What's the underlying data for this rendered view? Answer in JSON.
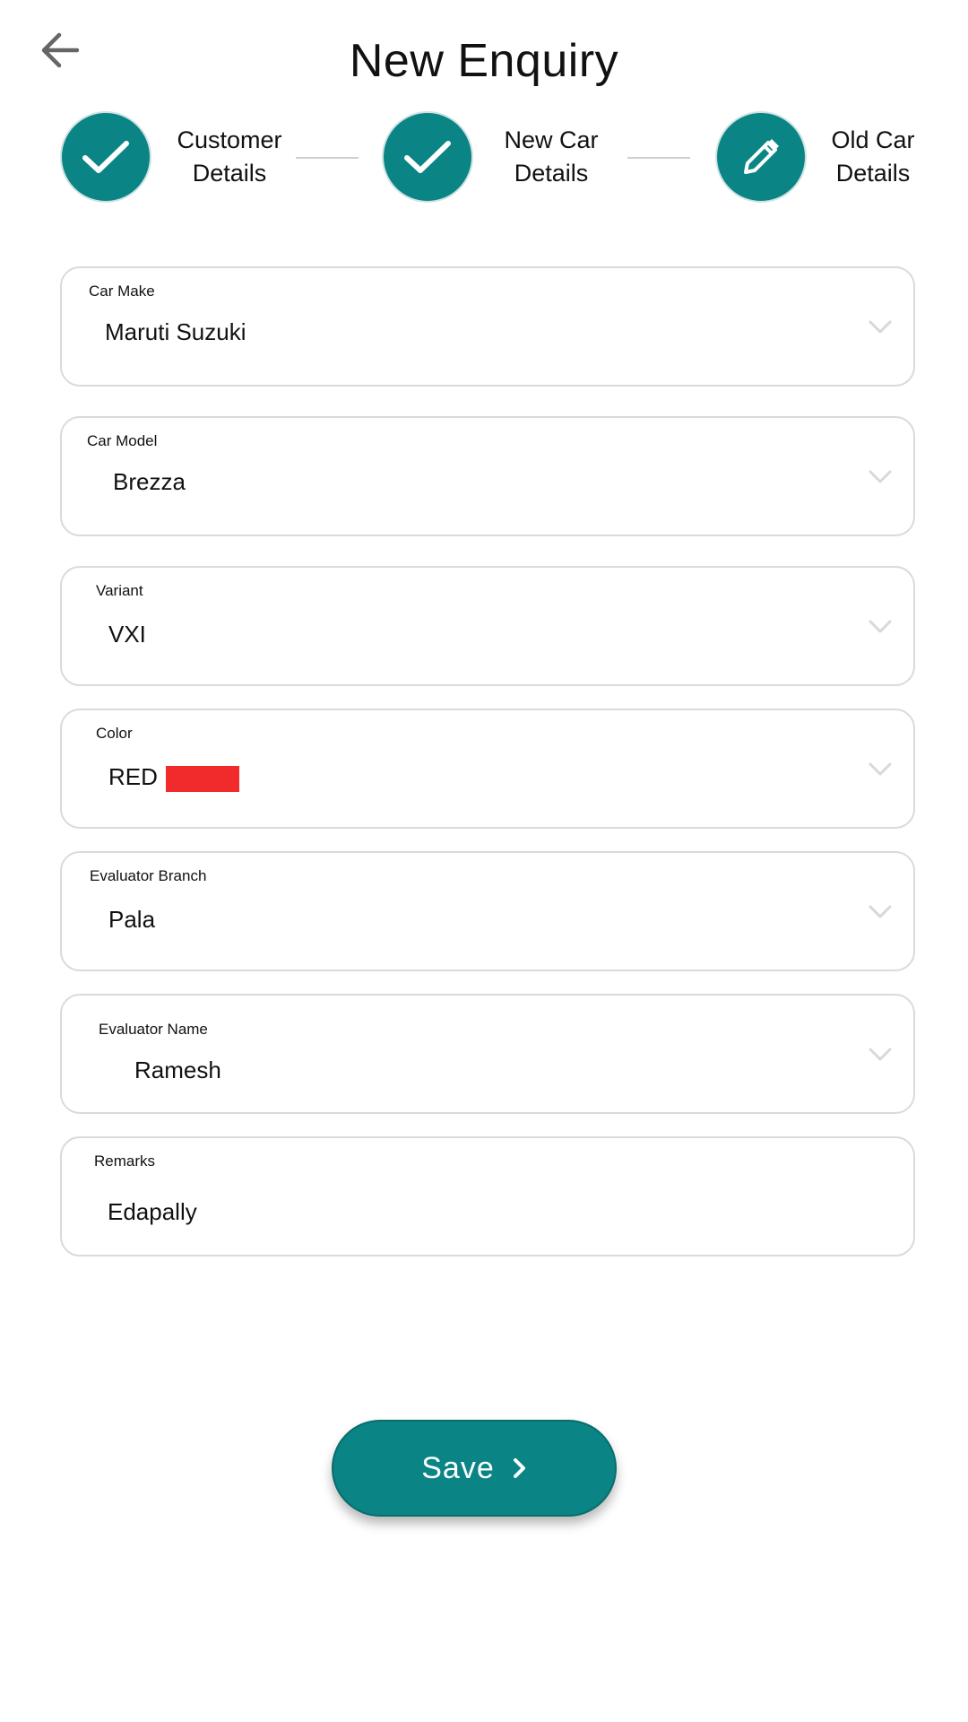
{
  "header": {
    "title": "New Enquiry",
    "back_icon": "arrow-left-icon"
  },
  "stepper": {
    "accent_color": "#0a8484",
    "steps": [
      {
        "label": "Customer\nDetails",
        "icon": "check-icon",
        "status": "completed"
      },
      {
        "label": "New Car\nDetails",
        "icon": "check-icon",
        "status": "completed"
      },
      {
        "label": "Old Car\nDetails",
        "icon": "pencil-icon",
        "status": "active"
      }
    ]
  },
  "form": {
    "fields": [
      {
        "label": "Car Make",
        "value": "Maruti Suzuki",
        "type": "dropdown"
      },
      {
        "label": "Car Model",
        "value": "Brezza",
        "type": "dropdown"
      },
      {
        "label": "Variant",
        "value": "VXI",
        "type": "dropdown"
      },
      {
        "label": "Color",
        "value": "RED",
        "swatch_color": "#f12b2b",
        "type": "dropdown"
      },
      {
        "label": "Evaluator Branch",
        "value": "Pala",
        "type": "dropdown"
      },
      {
        "label": "Evaluator Name",
        "value": "Ramesh",
        "type": "dropdown"
      },
      {
        "label": "Remarks",
        "value": "Edapally",
        "type": "text"
      }
    ]
  },
  "actions": {
    "save_label": "Save",
    "save_icon": "chevron-right-icon",
    "button_color": "#0a8484"
  }
}
